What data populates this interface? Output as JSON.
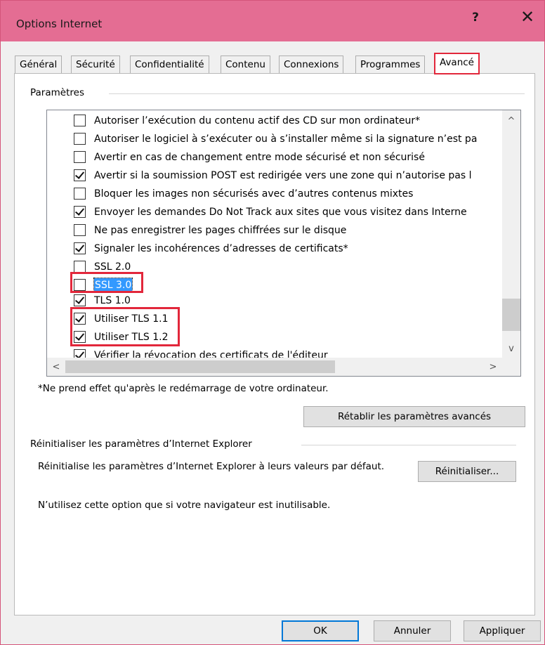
{
  "window": {
    "title": "Options Internet",
    "help": "?",
    "close": "✕"
  },
  "tabs": [
    {
      "label": "Général",
      "active": false
    },
    {
      "label": "Sécurité",
      "active": false
    },
    {
      "label": "Confidentialité",
      "active": false
    },
    {
      "label": "Contenu",
      "active": false
    },
    {
      "label": "Connexions",
      "active": false
    },
    {
      "label": "Programmes",
      "active": false
    },
    {
      "label": "Avancé",
      "active": true
    }
  ],
  "settings": {
    "group_label": "Paramètres",
    "items": [
      {
        "label": "Autoriser l’exécution du contenu actif des CD sur mon ordinateur*",
        "checked": false
      },
      {
        "label": "Autoriser le logiciel à s’exécuter ou à s’installer même si la signature n’est pa",
        "checked": false
      },
      {
        "label": "Avertir en cas de changement entre mode sécurisé et non sécurisé",
        "checked": false
      },
      {
        "label": "Avertir si la soumission POST est redirigée vers une zone qui n’autorise pas l",
        "checked": true
      },
      {
        "label": "Bloquer les images non sécurisés avec d’autres contenus mixtes",
        "checked": false
      },
      {
        "label": "Envoyer les demandes Do Not Track aux sites que vous visitez dans Interne",
        "checked": true
      },
      {
        "label": "Ne pas enregistrer les pages chiffrées sur le disque",
        "checked": false
      },
      {
        "label": "Signaler les incohérences d’adresses de certificats*",
        "checked": true
      },
      {
        "label": "SSL 2.0",
        "checked": false
      },
      {
        "label": "SSL 3.0",
        "checked": false,
        "selected": true
      },
      {
        "label": "TLS 1.0",
        "checked": true
      },
      {
        "label": "Utiliser TLS 1.1",
        "checked": true
      },
      {
        "label": "Utiliser TLS 1.2",
        "checked": true
      },
      {
        "label": "Vérifier la révocation des certificats de l'éditeur",
        "checked": true
      }
    ],
    "scroll_up": "^",
    "scroll_down": "v",
    "scroll_left": "<",
    "scroll_right": ">"
  },
  "note": "*Ne prend effet qu'après le redémarrage de votre ordinateur.",
  "restore_button": "Rétablir les paramètres avancés",
  "reset": {
    "group_label": "Réinitialiser les paramètres d’Internet Explorer",
    "description": "Réinitialise les paramètres d’Internet Explorer à leurs valeurs par défaut.",
    "button": "Réinitialiser...",
    "warning": "N’utilisez cette option que si votre navigateur est inutilisable."
  },
  "footer": {
    "ok": "OK",
    "cancel": "Annuler",
    "apply": "Appliquer"
  },
  "colors": {
    "titlebar": "#e46d93",
    "highlight": "#e2273b",
    "selection": "#3399ff"
  }
}
